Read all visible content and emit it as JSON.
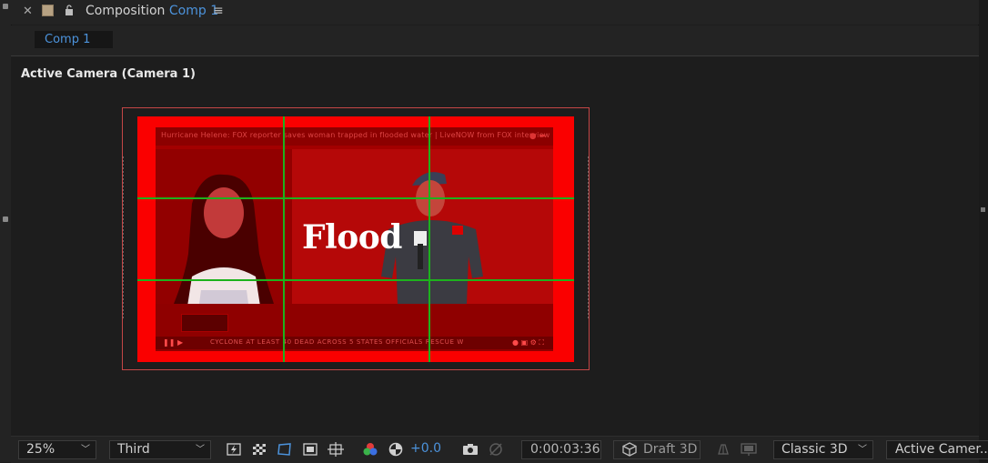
{
  "panel": {
    "title_prefix": "Composition",
    "title_comp": "Comp 1",
    "tab_label": "Comp 1"
  },
  "viewer": {
    "camera_label": "Active Camera (Camera 1)",
    "video_title": "Hurricane Helene: FOX reporter saves woman trapped in flooded water | LiveNOW from FOX interview",
    "headline": "Flood",
    "ticker": "CYCLONE AT LEAST 40 DEAD ACROSS 5 STATES    OFFICIALS RESCUE W",
    "overlay_color": "#fa0000",
    "grid_color": "#1db21d"
  },
  "toolbar": {
    "zoom": "25%",
    "resolution": "Third",
    "exposure": "+0.0",
    "timecode": "0:00:03:36",
    "draft_3d": "Draft 3D",
    "renderer": "Classic 3D",
    "view": "Active Camer..."
  },
  "colors": {
    "accent_blue": "#4c93dc",
    "panel_bg": "#232323"
  }
}
